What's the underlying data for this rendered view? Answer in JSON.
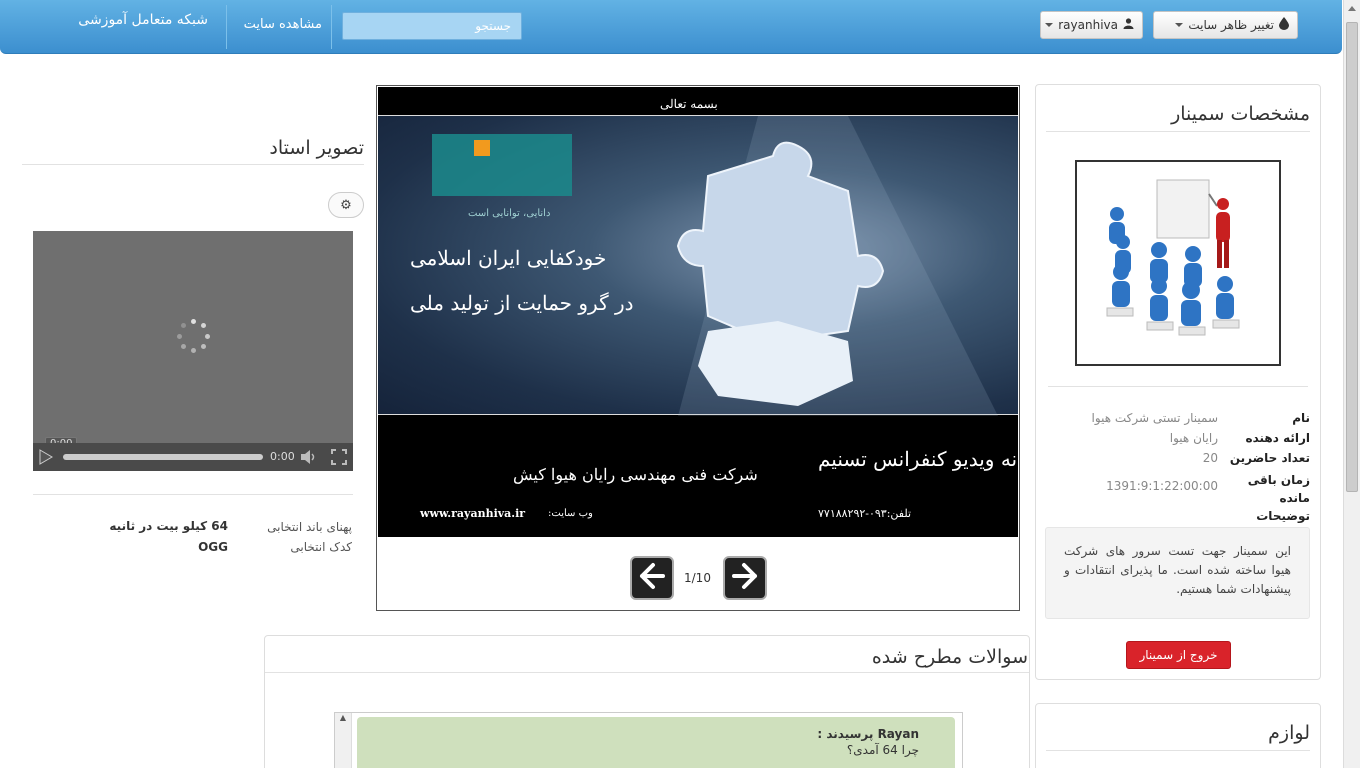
{
  "navbar": {
    "brand": "شبکه متعامل آموزشی",
    "view_site": "مشاهده سایت",
    "search_placeholder": "جستجو",
    "user_label": "rayanhiva",
    "theme_label": "تغییر ظاهر سایت"
  },
  "seminar": {
    "title": "مشخصات سمینار",
    "rows": [
      {
        "label": "نام",
        "value": "سمینار تستی شرکت هیوا"
      },
      {
        "label": "ارائه دهنده",
        "value": "رایان هیوا"
      },
      {
        "label": "تعداد حاضرین",
        "value": "20"
      },
      {
        "label": "زمان باقی مانده",
        "value": "1391:9:1:22:00:00"
      },
      {
        "label": "توضیحات",
        "value": ""
      }
    ],
    "description": "این سمینار جهت تست سرور های شرکت هیوا ساخته شده است. ما پذیرای انتقادات و پیشنهادات شما هستیم.",
    "exit_button": "خروج از سمینار"
  },
  "requirements": {
    "title": "لوازم"
  },
  "slides": {
    "header_text": "بسمه تعالی",
    "slogan_line1": "خودکفایی ایران اسلامی",
    "slogan_line2": "در گرو حمایت از تولید ملی",
    "logo_caption": "دانایی، توانایی است",
    "system_name": "سامانه ویدیو کنفرانس تسنیم",
    "company": "شرکت فنی مهندسی رایان هیوا کیش",
    "phone": "تلفن:۰۹۳-۷۷۱۸۸۲۹۲",
    "website_label": "وب سایت:",
    "website": "www.rayanhiva.ir",
    "counter": "1/10"
  },
  "teacher": {
    "title": "تصویر استاد",
    "time_badge": "0:00",
    "time_display": "0:00",
    "bandwidth_label": "پهنای باند انتخابی",
    "bandwidth_value": "64 کیلو بیت در ثانیه",
    "codec_label": "کدک انتخابی",
    "codec_value": "OGG"
  },
  "questions": {
    "title": "سوالات مطرح شده",
    "items": [
      {
        "author": "Rayan پرسیدند :",
        "text": "چرا 64 آمدی؟"
      }
    ]
  },
  "colors": {
    "navbar": "#4a9fd8",
    "exit_button": "#d9232a",
    "question_bg": "#cfe0bd"
  }
}
